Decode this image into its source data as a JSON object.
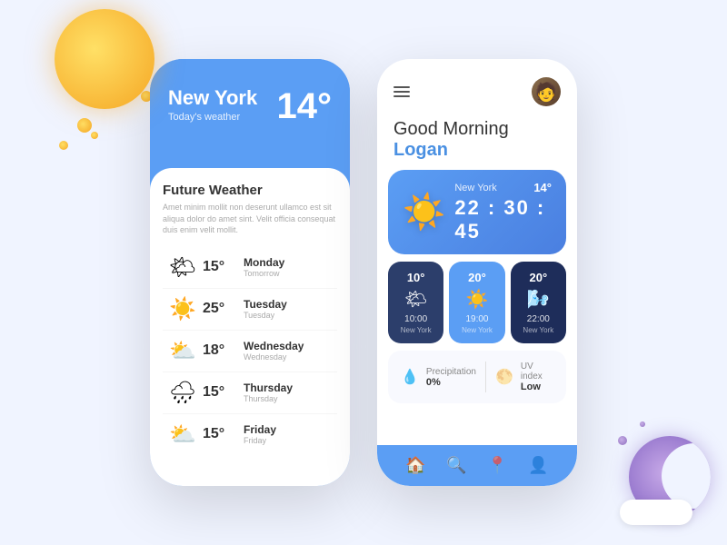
{
  "decorations": {
    "sun_alt": "sun decoration",
    "moon_alt": "moon decoration"
  },
  "left_phone": {
    "city": "New York",
    "today_label": "Today's weather",
    "temperature": "14°",
    "card": {
      "title": "Future Weather",
      "subtitle": "Amet minim mollit non deserunt ullamco est sit aliqua dolor do amet sint. Velit officia consequat duis enim velit mollit.",
      "rows": [
        {
          "icon": "🌤",
          "temp": "15°",
          "day": "Monday",
          "day_sub": "Tomorrow"
        },
        {
          "icon": "☀️",
          "temp": "25°",
          "day": "Tuesday",
          "day_sub": "Tuesday"
        },
        {
          "icon": "⛅",
          "temp": "18°",
          "day": "Wednesday",
          "day_sub": "Wednesday"
        },
        {
          "icon": "🌧",
          "temp": "15°",
          "day": "Thursday",
          "day_sub": "Thursday"
        },
        {
          "icon": "⛅",
          "temp": "15°",
          "day": "Friday",
          "day_sub": "Friday"
        }
      ]
    }
  },
  "right_phone": {
    "greeting_line1": "Good Morning",
    "greeting_name": "Logan",
    "big_card": {
      "city": "New York",
      "temp": "14°",
      "time": "22 : 30 : 45",
      "icon": "☀️"
    },
    "time_cards": [
      {
        "temp": "10°",
        "icon": "🌤",
        "time": "10:00",
        "city": "New York",
        "style": "dark"
      },
      {
        "temp": "20°",
        "icon": "☀️",
        "time": "19:00",
        "city": "New York",
        "style": "blue"
      },
      {
        "temp": "20°",
        "icon": "🌬",
        "time": "22:00",
        "city": "New York",
        "style": "navy"
      }
    ],
    "info": {
      "precipitation_label": "Precipitation",
      "precipitation_val": "0%",
      "uv_label": "UV index",
      "uv_val": "Low"
    },
    "nav": {
      "items": [
        "🏠",
        "🔍",
        "📍",
        "👤"
      ]
    }
  }
}
